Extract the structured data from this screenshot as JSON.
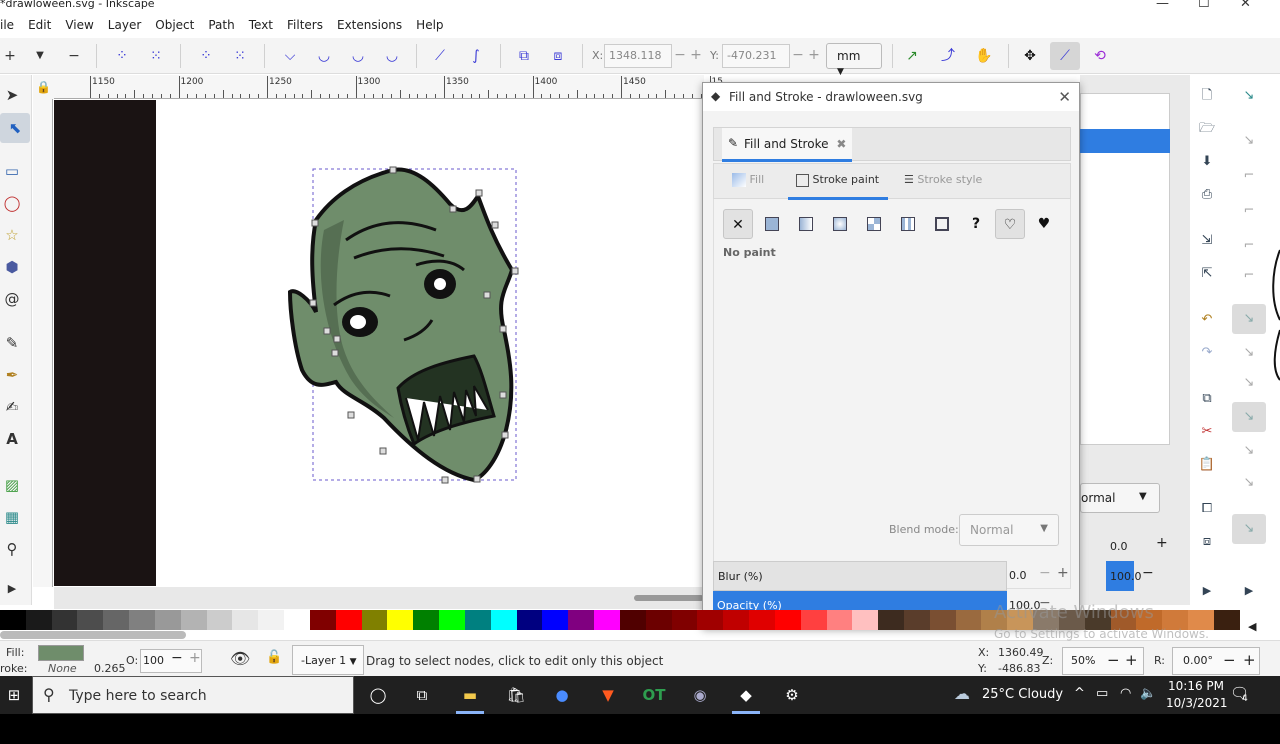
{
  "window": {
    "title": "*drawloween.svg - Inkscape",
    "controls": [
      "—",
      "☐",
      "✕"
    ]
  },
  "menu": [
    "ile",
    "Edit",
    "View",
    "Layer",
    "Object",
    "Path",
    "Text",
    "Filters",
    "Extensions",
    "Help"
  ],
  "command_bar": {
    "x_label": "X:",
    "x_value": "1348.118",
    "y_label": "Y:",
    "y_value": "-470.231",
    "unit": "mm",
    "minus": "−",
    "plus": "+"
  },
  "ruler": {
    "labels": [
      "1150",
      "1200",
      "1250",
      "1300",
      "1350",
      "1400",
      "1450",
      "15"
    ]
  },
  "dialog": {
    "title": "Fill and Stroke - drawloween.svg",
    "tab_label": "Fill and Stroke",
    "subtabs": {
      "fill": "Fill",
      "stroke_paint": "Stroke paint",
      "stroke_style": "Stroke style"
    },
    "paint_status": "No paint",
    "blend_label": "Blend mode:",
    "blend_value": "Normal",
    "blur_label": "Blur (%)",
    "blur_value": "0.0",
    "opacity_label": "Opacity (%)",
    "opacity_value": "100.0",
    "unknown_symbol": "?"
  },
  "right_panel": {
    "blend_value": "ormal",
    "blur_value": "0.0",
    "opacity_value": "100.0"
  },
  "status": {
    "fill_label": "Fill:",
    "stroke_label": "roke:",
    "stroke_value": "None",
    "stroke_width": "0.265",
    "opacity_label": "O:",
    "opacity_value": "100",
    "layer": "-Layer 1",
    "message": "Drag to select nodes, click to edit only this object",
    "x_label": "X:",
    "x_value": "1360.49",
    "y_label": "Y:",
    "y_value": "-486.83",
    "zoom_label": "Z:",
    "zoom_value": "50%",
    "rotation_label": "R:",
    "rotation_value": "0.00°"
  },
  "watermark": {
    "line1": "Activate Windows",
    "line2": "Go to Settings to activate Windows."
  },
  "taskbar": {
    "search_placeholder": "Type here to search",
    "weather": "25°C  Cloudy",
    "time": "10:16 PM",
    "date": "10/3/2021",
    "notifications": "4"
  },
  "colors": {
    "accent": "#2f7de1",
    "zombie_fill": "#6f8d6b"
  },
  "palette": [
    "#000000",
    "#1a1a1a",
    "#333333",
    "#4d4d4d",
    "#666666",
    "#808080",
    "#999999",
    "#b3b3b3",
    "#cccccc",
    "#e6e6e6",
    "#f2f2f2",
    "#ffffff",
    "#800000",
    "#ff0000",
    "#808000",
    "#ffff00",
    "#008000",
    "#00ff00",
    "#008080",
    "#00ffff",
    "#000080",
    "#0000ff",
    "#800080",
    "#ff00ff",
    "#500000",
    "#6c0000",
    "#800000",
    "#a00000",
    "#c00000",
    "#e00000",
    "#ff0000",
    "#ff4040",
    "#ff8080",
    "#ffc0c0",
    "#3d2b1f",
    "#5a3d2b",
    "#7a4f32",
    "#9a6a3f",
    "#b0804a",
    "#c8955a",
    "#8a7a6a",
    "#6b5a4a",
    "#4a3a2a",
    "#a05a2a",
    "#c06a2a",
    "#d07a3a",
    "#e08a4a",
    "#3a2010"
  ]
}
